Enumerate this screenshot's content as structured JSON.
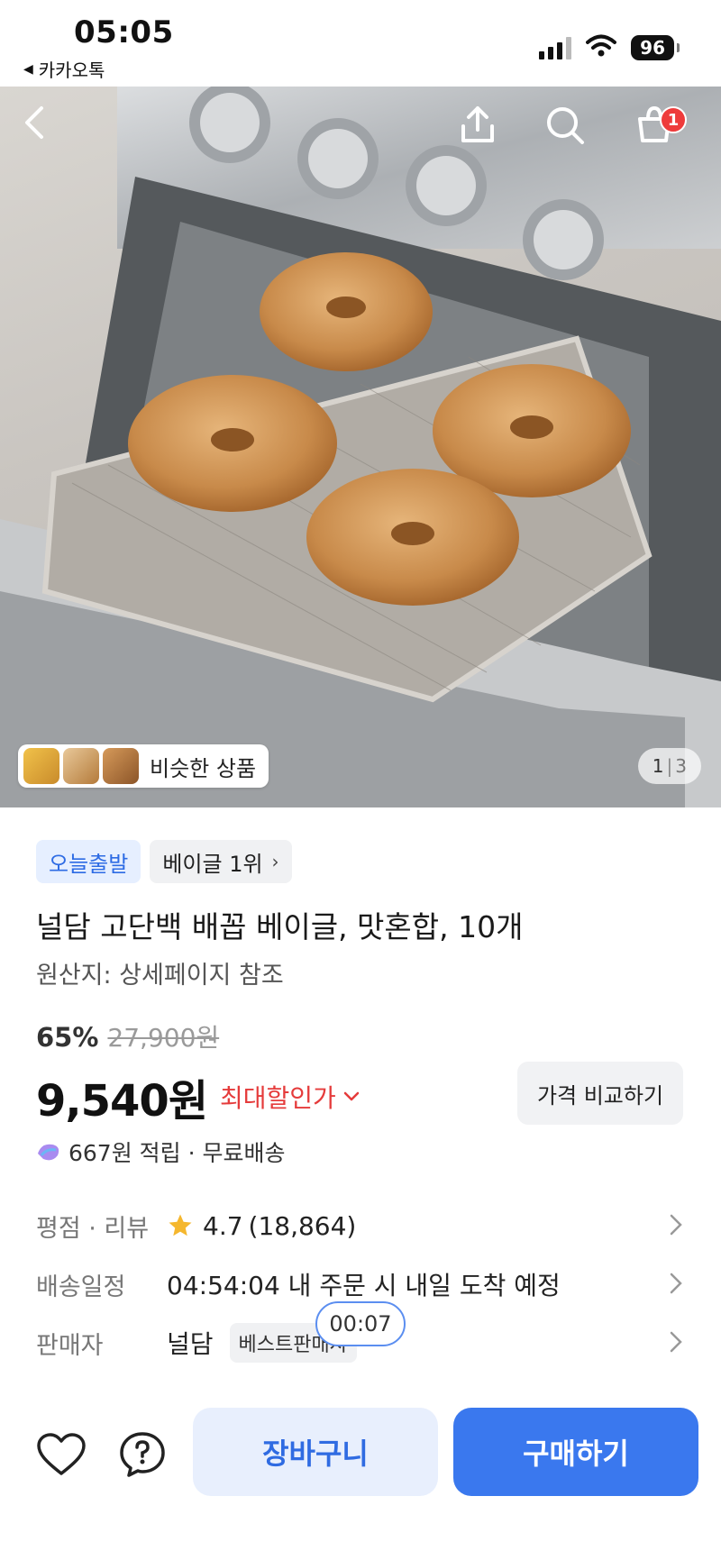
{
  "status_bar": {
    "time": "05:05",
    "back_app": "카카오톡",
    "battery": "96"
  },
  "header": {
    "cart_count": "1"
  },
  "gallery": {
    "similar_label": "비슷한 상품",
    "page_current": "1",
    "page_separator": "|",
    "page_total": "3"
  },
  "product": {
    "tags": [
      {
        "label": "오늘출발"
      },
      {
        "label": "베이글 1위"
      }
    ],
    "title": "널담 고단백 배꼽 베이글, 맛혼합, 10개",
    "origin": "원산지: 상세페이지 참조",
    "discount": "65%",
    "original_price": "27,900원",
    "price": "9,540원",
    "max_discount_label": "최대할인가",
    "compare_button": "가격 비교하기",
    "points": "667원 적립 · 무료배송"
  },
  "info": {
    "rating": {
      "label": "평점 · 리뷰",
      "score": "4.7",
      "count": "(18,864)"
    },
    "delivery": {
      "label": "배송일정",
      "value": "04:54:04 내 주문 시 내일 도착 예정"
    },
    "seller": {
      "label": "판매자",
      "name": "널담",
      "badge": "베스트판매자"
    },
    "timer": "00:07"
  },
  "bottom_bar": {
    "cart_button": "장바구니",
    "buy_button": "구매하기"
  },
  "colors": {
    "primary": "#3a78ee",
    "accent_red": "#e53b3b",
    "badge_red": "#ee3b3b"
  }
}
